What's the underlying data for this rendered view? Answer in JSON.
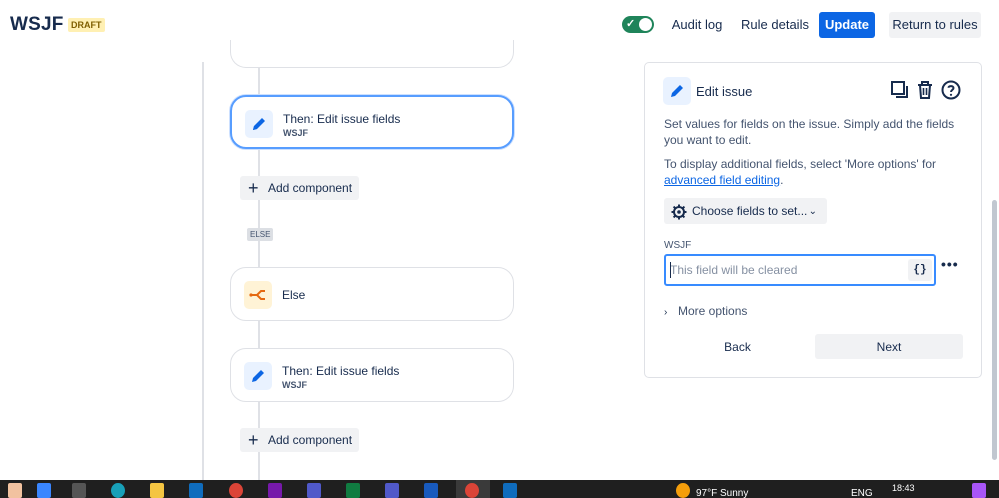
{
  "header": {
    "title": "WSJF",
    "badge": "DRAFT",
    "toggle_on": true,
    "audit_log": "Audit log",
    "rule_details": "Rule details",
    "update": "Update",
    "return_to_rules": "Return to rules"
  },
  "flow": {
    "cards": [
      {
        "title": "Then: Edit issue fields",
        "subtitle": "WSJF",
        "icon": "pencil-icon"
      },
      {
        "title": "Else",
        "icon": "branch-icon"
      },
      {
        "title": "Then: Edit issue fields",
        "subtitle": "WSJF",
        "icon": "pencil-icon"
      }
    ],
    "add_component": "Add component",
    "else_tag": "ELSE"
  },
  "panel": {
    "title": "Edit issue",
    "description": "Set values for fields on the issue. Simply add the fields you want to edit.",
    "additional_prefix": "To display additional fields, select 'More options' for",
    "advanced_link": "advanced field editing",
    "additional_suffix": ".",
    "choose_fields": "Choose fields to set...",
    "field_label": "WSJF",
    "field_placeholder": "This field will be cleared",
    "field_value": "",
    "braces": "{}",
    "more_options": "More options",
    "back": "Back",
    "next": "Next"
  },
  "taskbar": {
    "weather": "97°F  Sunny",
    "lang": "ENG",
    "time": "18:43"
  },
  "colors": {
    "accent": "#0c66e4",
    "toggle": "#1f845a",
    "selected_border": "#579dff",
    "badge_bg": "#fff0b3"
  }
}
